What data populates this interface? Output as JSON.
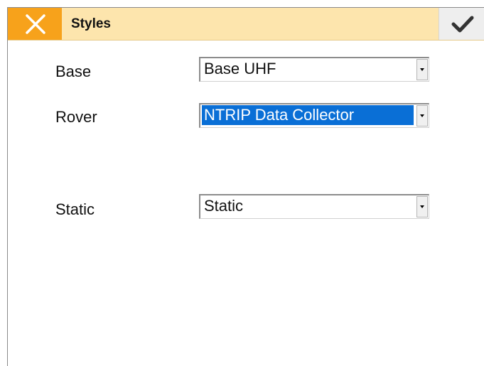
{
  "header": {
    "title": "Styles",
    "close_icon": "close-x-icon",
    "confirm_icon": "checkmark-icon",
    "accent_color": "#f7a21b",
    "bar_color": "#fde5ad"
  },
  "fields": {
    "base": {
      "label": "Base",
      "value": "Base UHF"
    },
    "rover": {
      "label": "Rover",
      "value": "NTRIP Data Collector",
      "selected": true,
      "highlight_color": "#0a6fd6"
    },
    "static": {
      "label": "Static",
      "value": "Static"
    }
  }
}
